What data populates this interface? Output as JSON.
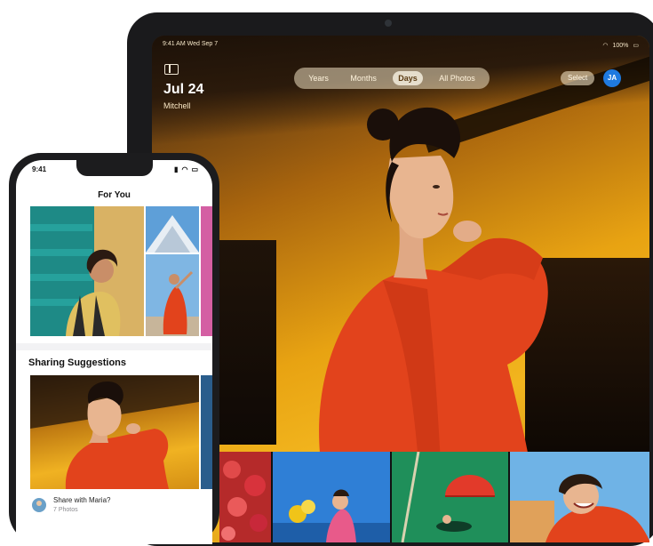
{
  "ipad": {
    "status_time": "9:41 AM  Wed Sep 7",
    "status_battery": "100%",
    "date": "Jul 24",
    "location": "Mitchell",
    "tabs": [
      {
        "label": "Years",
        "active": false
      },
      {
        "label": "Months",
        "active": false
      },
      {
        "label": "Days",
        "active": true
      },
      {
        "label": "All Photos",
        "active": false
      }
    ],
    "select_label": "Select",
    "avatar_initials": "JA"
  },
  "iphone": {
    "status_time": "9:41",
    "title": "For You",
    "sharing_title": "Sharing Suggestions",
    "share_with": "Share with Maria?",
    "share_count": "7 Photos"
  },
  "colors": {
    "accent": "#1f7ae0",
    "dress_red": "#e2431c",
    "background_amber": "#e8a312"
  }
}
